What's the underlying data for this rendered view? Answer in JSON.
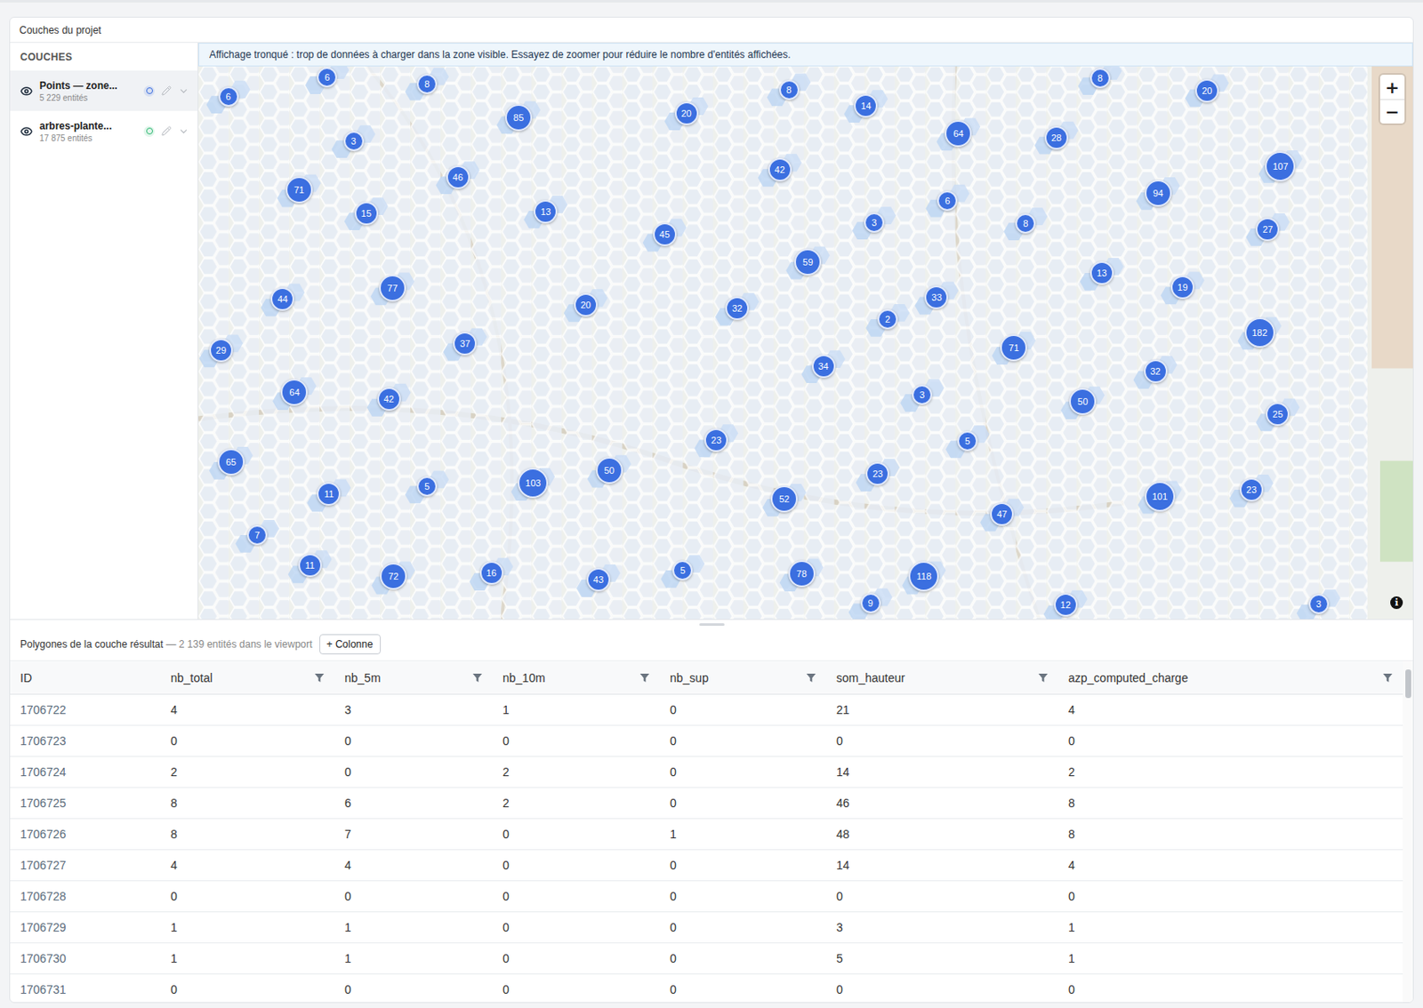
{
  "panel": {
    "title": "Couches du projet"
  },
  "sidebar": {
    "header": "COUCHES",
    "layers": [
      {
        "name": "Points — zone...",
        "count": "5 229 entités",
        "visible": true,
        "selected": true,
        "color": "#3b6fe0"
      },
      {
        "name": "arbres-plante...",
        "count": "17 875 entités",
        "visible": true,
        "selected": false,
        "color": "#2eb872"
      }
    ]
  },
  "map": {
    "banner": "Affichage tronqué : trop de données à charger dans la zone visible. Essayez de zoomer pour réduire le nombre d'entités affichées.",
    "zoom_in": "+",
    "zoom_out": "−",
    "info": "i",
    "clusters": [
      {
        "label": "6"
      },
      {
        "label": "6"
      },
      {
        "label": "8"
      },
      {
        "label": "85"
      },
      {
        "label": "20"
      },
      {
        "label": "8"
      },
      {
        "label": "14"
      },
      {
        "label": "64"
      },
      {
        "label": "8"
      },
      {
        "label": "20"
      },
      {
        "label": "28"
      },
      {
        "label": "107"
      },
      {
        "label": "94"
      },
      {
        "label": "71"
      },
      {
        "label": "3"
      },
      {
        "label": "46"
      },
      {
        "label": "15"
      },
      {
        "label": "13"
      },
      {
        "label": "45"
      },
      {
        "label": "42"
      },
      {
        "label": "59"
      },
      {
        "label": "3"
      },
      {
        "label": "6"
      },
      {
        "label": "8"
      },
      {
        "label": "27"
      },
      {
        "label": "13"
      },
      {
        "label": "19"
      },
      {
        "label": "44"
      },
      {
        "label": "77"
      },
      {
        "label": "20"
      },
      {
        "label": "32"
      },
      {
        "label": "33"
      },
      {
        "label": "2"
      },
      {
        "label": "71"
      },
      {
        "label": "182"
      },
      {
        "label": "29"
      },
      {
        "label": "37"
      },
      {
        "label": "34"
      },
      {
        "label": "32"
      },
      {
        "label": "64"
      },
      {
        "label": "42"
      },
      {
        "label": "3"
      },
      {
        "label": "50"
      },
      {
        "label": "25"
      },
      {
        "label": "65"
      },
      {
        "label": "23"
      },
      {
        "label": "5"
      },
      {
        "label": "11"
      },
      {
        "label": "5"
      },
      {
        "label": "103"
      },
      {
        "label": "50"
      },
      {
        "label": "52"
      },
      {
        "label": "23"
      },
      {
        "label": "101"
      },
      {
        "label": "23"
      },
      {
        "label": "47"
      },
      {
        "label": "7"
      },
      {
        "label": "11"
      },
      {
        "label": "72"
      },
      {
        "label": "16"
      },
      {
        "label": "43"
      },
      {
        "label": "5"
      },
      {
        "label": "78"
      },
      {
        "label": "118"
      },
      {
        "label": "9"
      },
      {
        "label": "12"
      },
      {
        "label": "3"
      }
    ]
  },
  "table": {
    "title": "Polygones de la couche résultat",
    "subtitle": "— 2 139 entités dans le viewport",
    "add_column": "+ Colonne",
    "columns": [
      {
        "label": "ID",
        "filter": false
      },
      {
        "label": "nb_total",
        "filter": true
      },
      {
        "label": "nb_5m",
        "filter": true
      },
      {
        "label": "nb_10m",
        "filter": true
      },
      {
        "label": "nb_sup",
        "filter": true
      },
      {
        "label": "som_hauteur",
        "filter": true
      },
      {
        "label": "azp_computed_charge",
        "filter": true
      }
    ],
    "rows": [
      [
        "1706722",
        "4",
        "3",
        "1",
        "0",
        "21",
        "4"
      ],
      [
        "1706723",
        "0",
        "0",
        "0",
        "0",
        "0",
        "0"
      ],
      [
        "1706724",
        "2",
        "0",
        "2",
        "0",
        "14",
        "2"
      ],
      [
        "1706725",
        "8",
        "6",
        "2",
        "0",
        "46",
        "8"
      ],
      [
        "1706726",
        "8",
        "7",
        "0",
        "1",
        "48",
        "8"
      ],
      [
        "1706727",
        "4",
        "4",
        "0",
        "0",
        "14",
        "4"
      ],
      [
        "1706728",
        "0",
        "0",
        "0",
        "0",
        "0",
        "0"
      ],
      [
        "1706729",
        "1",
        "1",
        "0",
        "0",
        "3",
        "1"
      ],
      [
        "1706730",
        "1",
        "1",
        "0",
        "0",
        "5",
        "1"
      ],
      [
        "1706731",
        "0",
        "0",
        "0",
        "0",
        "0",
        "0"
      ]
    ]
  }
}
